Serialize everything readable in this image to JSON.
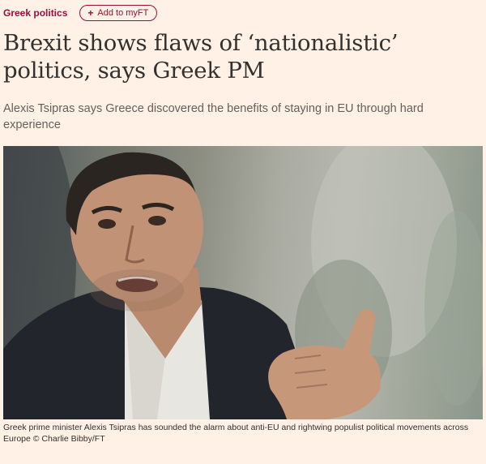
{
  "topic": {
    "label": "Greek politics"
  },
  "myft": {
    "icon": "plus-icon",
    "label": "Add to myFT"
  },
  "article": {
    "headline": "Brexit shows flaws of ‘nationalistic’ politics, says Greek PM",
    "standfirst": "Alexis Tsipras says Greece discovered the benefits of staying in EU through hard experience",
    "caption": "Greek prime minister Alexis Tsipras has sounded the alarm about anti-EU and rightwing populist political movements across Europe © Charlie Bibby/FT"
  },
  "colors": {
    "page_background": "#fff1e5",
    "accent": "#990f3d",
    "text": "#33302e",
    "muted_text": "#66605c"
  }
}
